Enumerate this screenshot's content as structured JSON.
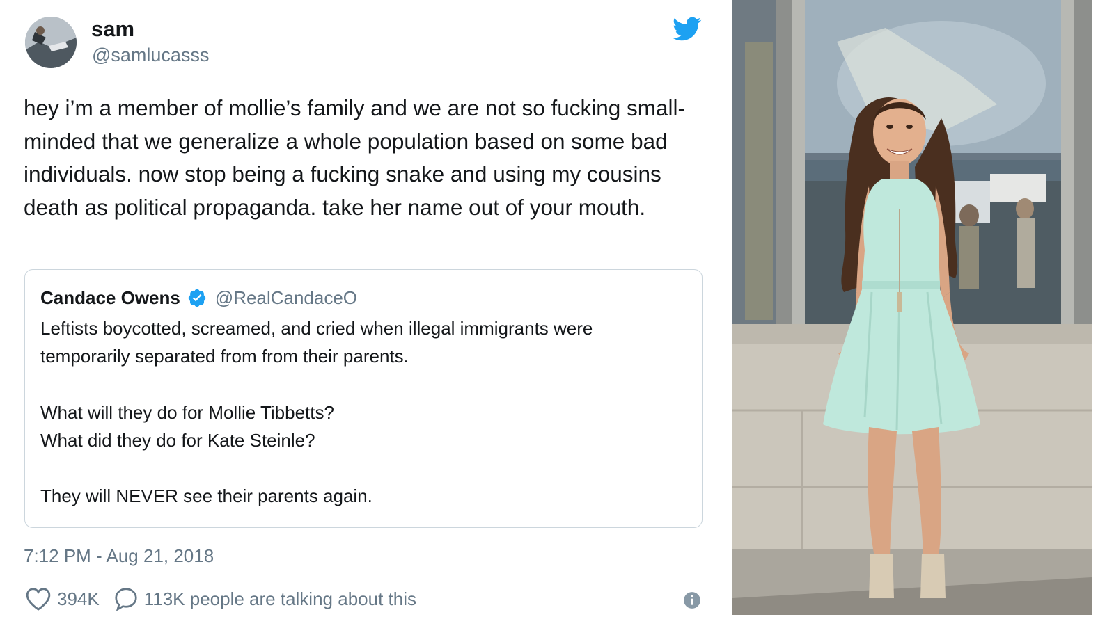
{
  "tweet": {
    "author": {
      "name": "sam",
      "handle": "@samlucasss"
    },
    "text": "hey i’m a member of mollie’s family and we are not so fucking small-minded that we generalize a whole population based on some bad individuals. now stop being a fucking snake and using my cousins death as political propaganda. take her name out of your mouth.",
    "quoted": {
      "name": "Candace Owens",
      "handle": "@RealCandaceO",
      "lines": [
        "Leftists boycotted, screamed, and cried when illegal immigrants were",
        "temporarily separated from from their parents.",
        "",
        "What will they do for Mollie Tibbetts?",
        "What did they do for Kate Steinle?",
        "",
        "They will NEVER see their parents again."
      ]
    },
    "timestamp": "7:12 PM - Aug 21, 2018",
    "likes": "394K",
    "talking": "113K people are talking about this"
  },
  "icons": {
    "bird": "twitter-bird-icon",
    "verified": "verified-badge-icon",
    "heart": "heart-icon",
    "bubble": "speech-bubble-icon",
    "info": "info-icon"
  },
  "colors": {
    "twitter_blue": "#1da1f2",
    "text": "#14171a",
    "muted": "#657786",
    "border": "#ccd6dd",
    "dress": "#bfe8dc"
  }
}
